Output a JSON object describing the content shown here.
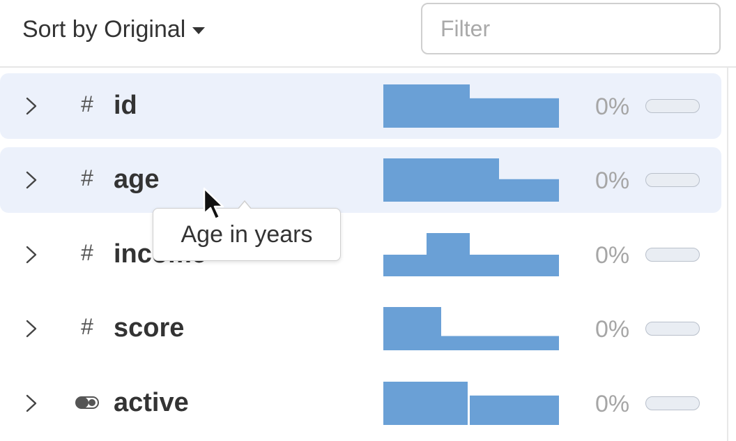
{
  "header": {
    "sort_label": "Sort by Original",
    "filter_placeholder": "Filter",
    "filter_value": ""
  },
  "colors": {
    "histogram": "#6aa0d6",
    "row_highlight": "#ecf1fb",
    "percent_text": "#a6a6a6"
  },
  "columns": [
    {
      "name": "id",
      "type_icon": "hash-icon",
      "missing_pct": "0%",
      "highlighted": true,
      "histogram": [
        1.0,
        0.68
      ]
    },
    {
      "name": "age",
      "type_icon": "hash-icon",
      "missing_pct": "0%",
      "highlighted": true,
      "histogram": [
        1.0,
        0.52
      ]
    },
    {
      "name": "income",
      "type_icon": "hash-icon",
      "missing_pct": "0%",
      "highlighted": false,
      "histogram": [
        0.5,
        1.0,
        0.5
      ]
    },
    {
      "name": "score",
      "type_icon": "hash-icon",
      "missing_pct": "0%",
      "highlighted": false,
      "histogram": [
        1.0,
        0.33
      ]
    },
    {
      "name": "active",
      "type_icon": "toggle-icon",
      "missing_pct": "0%",
      "highlighted": false,
      "histogram": [
        1.0,
        0.68
      ]
    }
  ],
  "tooltip": {
    "text": "Age in years"
  },
  "type_symbols": {
    "hash": "#"
  }
}
